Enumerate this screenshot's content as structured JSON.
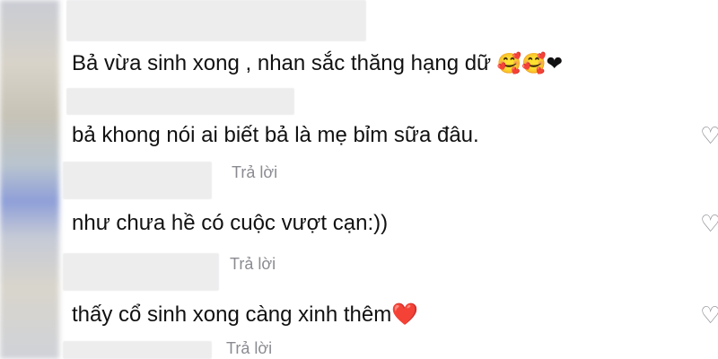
{
  "comments": [
    {
      "text": "Bả vừa sinh xong , nhan sắc thăng hạng dữ",
      "suffix_emojis": "🥰🥰",
      "suffix_heart": "❤"
    },
    {
      "text": "bả khong nói ai biết bả là mẹ bỉm sữa đâu."
    },
    {
      "text": "như chưa hề có cuộc vượt cạn:))",
      "reply_label": "Trả lời"
    },
    {
      "text": "thấy cổ sinh xong càng xinh thêm",
      "suffix_heart": "❤️",
      "reply_label": "Trả lời"
    }
  ],
  "reply_labels": [
    "Trả lời",
    "Trả lời",
    "Trả lời"
  ],
  "icons": {
    "like": "heart-outline-icon"
  },
  "colors": {
    "reply": "#8a8b91",
    "heart": "#e8262e"
  }
}
